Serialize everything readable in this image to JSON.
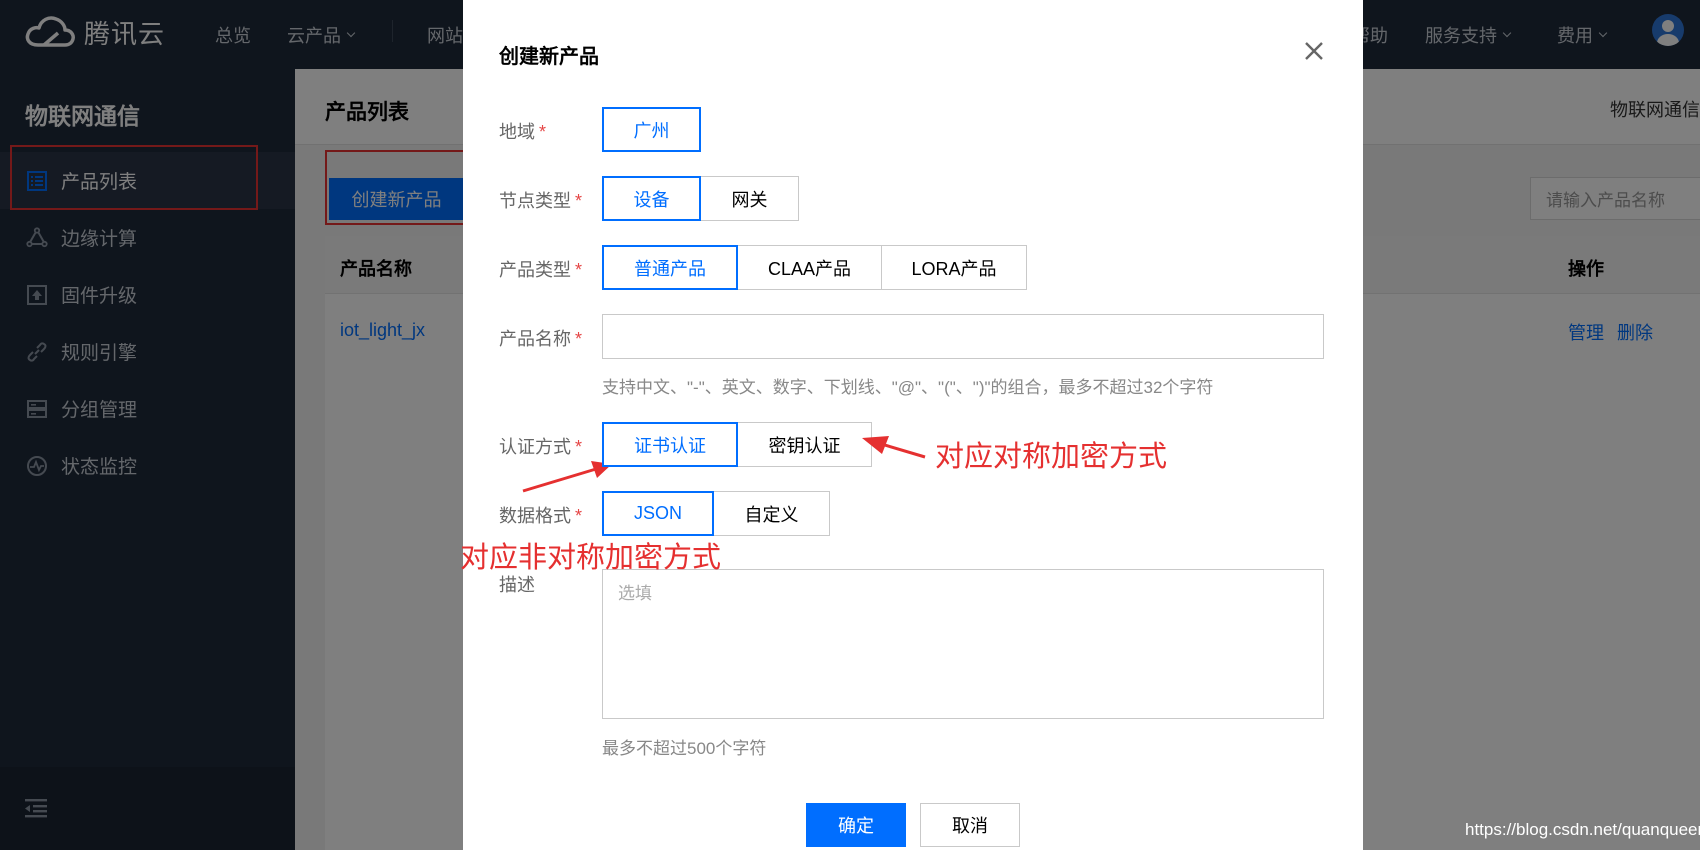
{
  "topbar": {
    "brand": "腾讯云",
    "nav": [
      "总览",
      "云产品",
      "网站",
      "帮助",
      "服务支持",
      "费用"
    ],
    "colors": {
      "bg": "#1f2a3a",
      "accent": "#006eff"
    }
  },
  "sidebar": {
    "title": "物联网通信",
    "items": [
      {
        "label": "产品列表",
        "icon": "list-icon"
      },
      {
        "label": "边缘计算",
        "icon": "edge-compute-icon"
      },
      {
        "label": "固件升级",
        "icon": "upgrade-icon"
      },
      {
        "label": "规则引擎",
        "icon": "link-icon"
      },
      {
        "label": "分组管理",
        "icon": "server-group-icon"
      },
      {
        "label": "状态监控",
        "icon": "monitor-icon"
      }
    ]
  },
  "main": {
    "title": "产品列表",
    "breadcrumb_right": "物联网通信",
    "create_button": "创建新产品",
    "search_placeholder": "请输入产品名称",
    "table": {
      "columns": [
        "产品名称",
        "操作"
      ],
      "rows": [
        {
          "name": "iot_light_jx",
          "actions": [
            "管理",
            "删除"
          ]
        }
      ]
    }
  },
  "modal": {
    "title": "创建新产品",
    "required_mark": "*",
    "fields": {
      "region": {
        "label": "地域",
        "options": [
          "广州"
        ],
        "selected": "广州"
      },
      "node_type": {
        "label": "节点类型",
        "options": [
          "设备",
          "网关"
        ],
        "selected": "设备"
      },
      "product_type": {
        "label": "产品类型",
        "options": [
          "普通产品",
          "CLAA产品",
          "LORA产品"
        ],
        "selected": "普通产品"
      },
      "product_name": {
        "label": "产品名称",
        "value": "",
        "hint": "支持中文、\"-\"、英文、数字、下划线、\"@\"、\"(\"、\")\"的组合，最多不超过32个字符"
      },
      "auth": {
        "label": "认证方式",
        "options": [
          "证书认证",
          "密钥认证"
        ],
        "selected": "证书认证"
      },
      "data_format": {
        "label": "数据格式",
        "options": [
          "JSON",
          "自定义"
        ],
        "selected": "JSON"
      },
      "description": {
        "label": "描述",
        "placeholder": "选填",
        "hint": "最多不超过500个字符"
      }
    },
    "confirm": "确定",
    "cancel": "取消"
  },
  "annotations": {
    "symmetric": "对应对称加密方式",
    "asymmetric": "对应非对称加密方式"
  },
  "watermark": "https://blog.csdn.net/quanqueen"
}
